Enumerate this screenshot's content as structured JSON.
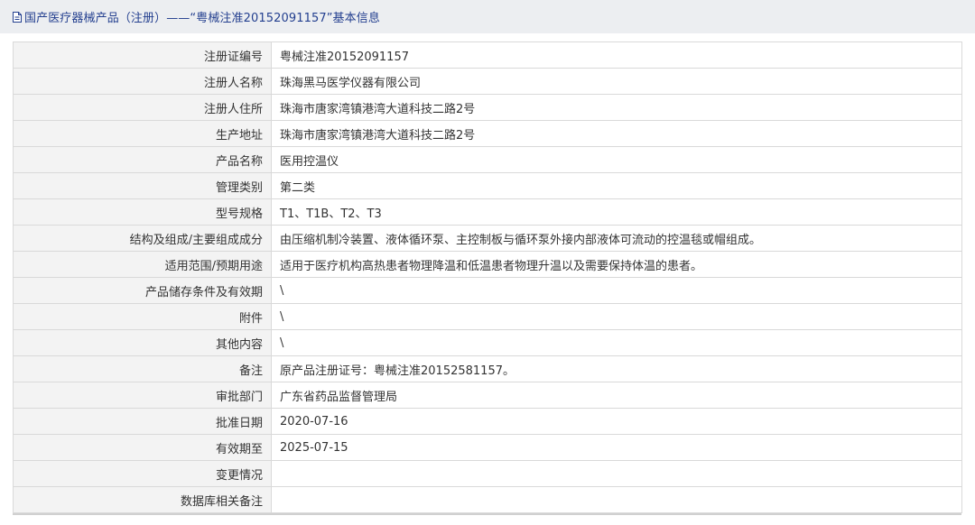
{
  "header": {
    "icon": "document-icon",
    "title": "国产医疗器械产品（注册）——“粤械注准20152091157”基本信息",
    "title_color": "#233f8f",
    "background": "#eceef1"
  },
  "rows": [
    {
      "label": "注册证编号",
      "value": "粤械注准20152091157"
    },
    {
      "label": "注册人名称",
      "value": "珠海黑马医学仪器有限公司"
    },
    {
      "label": "注册人住所",
      "value": "珠海市唐家湾镇港湾大道科技二路2号"
    },
    {
      "label": "生产地址",
      "value": "珠海市唐家湾镇港湾大道科技二路2号"
    },
    {
      "label": "产品名称",
      "value": "医用控温仪"
    },
    {
      "label": "管理类别",
      "value": "第二类"
    },
    {
      "label": "型号规格",
      "value": "T1、T1B、T2、T3"
    },
    {
      "label": "结构及组成/主要组成成分",
      "value": "由压缩机制冷装置、液体循环泵、主控制板与循环泵外接内部液体可流动的控温毯或帽组成。"
    },
    {
      "label": "适用范围/预期用途",
      "value": "适用于医疗机构高热患者物理降温和低温患者物理升温以及需要保持体温的患者。"
    },
    {
      "label": "产品储存条件及有效期",
      "value": "\\"
    },
    {
      "label": "附件",
      "value": "\\"
    },
    {
      "label": "其他内容",
      "value": "\\"
    },
    {
      "label": "备注",
      "value": "原产品注册证号：粤械注准20152581157。"
    },
    {
      "label": "审批部门",
      "value": "广东省药品监督管理局"
    },
    {
      "label": "批准日期",
      "value": "2020-07-16"
    },
    {
      "label": "有效期至",
      "value": "2025-07-15"
    },
    {
      "label": "变更情况",
      "value": ""
    },
    {
      "label": "数据库相关备注",
      "value": ""
    }
  ]
}
